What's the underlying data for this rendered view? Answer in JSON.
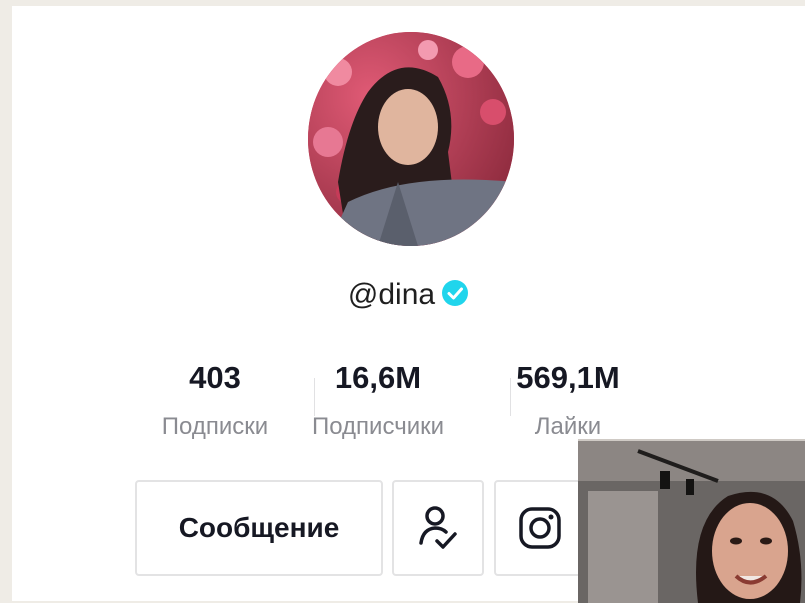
{
  "profile": {
    "username": "@dina",
    "verified": true,
    "avatar_icon": "profile-photo"
  },
  "stats": [
    {
      "value": "403",
      "label": "Подписки"
    },
    {
      "value": "16,6M",
      "label": "Подписчики"
    },
    {
      "value": "569,1M",
      "label": "Лайки"
    }
  ],
  "actions": {
    "message_label": "Сообщение",
    "follow_icon": "user-check-icon",
    "instagram_icon": "instagram-icon"
  },
  "pip": {
    "icon": "video-preview"
  },
  "colors": {
    "verified": "#20d5ec",
    "text": "#161823",
    "muted": "#8a8b91",
    "border": "#e3e3e4"
  }
}
